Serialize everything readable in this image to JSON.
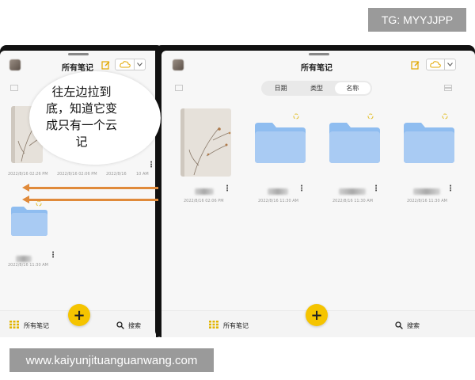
{
  "watermarks": {
    "top": "TG: MYYJJPP",
    "bottom": "www.kaiyunjituanguanwang.com"
  },
  "left_screen": {
    "title": "所有笔记",
    "bubble_text": "往左边拉到底，知道它变成只有一个云记",
    "book_date": "2022/8/16 02:26 PM",
    "book_date_2": "2022/8/16 02:06 PM",
    "book_date_3": "2022/8/16",
    "book_date_4": "10 AM",
    "folder_date": "2022/8/16 11:30 AM",
    "nav_all": "所有笔记",
    "nav_search": "搜索",
    "fab": "+"
  },
  "right_screen": {
    "title": "所有笔记",
    "sort_tabs": [
      "日期",
      "类型",
      "名称"
    ],
    "active_sort": "名称",
    "items": [
      {
        "kind": "notebook",
        "date": "2022/8/16 02:06 PM"
      },
      {
        "kind": "folder",
        "date": "2022/8/16 11:30 AM"
      },
      {
        "kind": "folder",
        "date": "2022/8/16 11:30 AM"
      },
      {
        "kind": "folder",
        "date": "2022/8/16 11:30 AM"
      }
    ],
    "nav_all": "所有笔记",
    "nav_search": "搜索",
    "fab": "+"
  },
  "colors": {
    "accent": "#f5c400",
    "folder": "#8fbdf0",
    "arrow": "#e08a3a"
  }
}
